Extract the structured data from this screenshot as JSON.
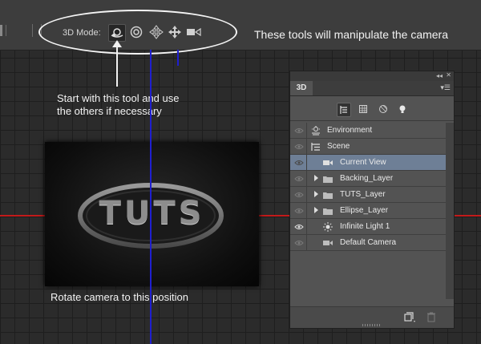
{
  "toolbar": {
    "mode_label": "3D Mode:",
    "tools": [
      {
        "name": "rotate-3d-camera-icon",
        "active": true
      },
      {
        "name": "roll-3d-camera-icon",
        "active": false
      },
      {
        "name": "drag-3d-camera-icon",
        "active": false
      },
      {
        "name": "slide-3d-camera-icon",
        "active": false
      },
      {
        "name": "zoom-3d-camera-icon",
        "active": false
      }
    ]
  },
  "annotations": {
    "tools_caption": "These tools will manipulate the camera",
    "start_line1": "Start with this tool and use",
    "start_line2": "the others if necessary",
    "rotate_caption": "Rotate camera to this position"
  },
  "canvas": {
    "logo_text": "TUTS"
  },
  "panel": {
    "tab_label": "3D",
    "filters": [
      "whole-scene-filter-icon",
      "meshes-filter-icon",
      "materials-filter-icon",
      "lights-filter-icon"
    ],
    "layers": [
      {
        "label": "Environment",
        "icon": "environment-icon",
        "indent": 0,
        "expander": false,
        "selected": false
      },
      {
        "label": "Scene",
        "icon": "scene-icon",
        "indent": 0,
        "expander": false,
        "selected": false
      },
      {
        "label": "Current View",
        "icon": "camera-icon",
        "indent": 1,
        "expander": false,
        "selected": true
      },
      {
        "label": "Backing_Layer",
        "icon": "mesh-icon",
        "indent": 1,
        "expander": true,
        "selected": false
      },
      {
        "label": "TUTS_Layer",
        "icon": "mesh-icon",
        "indent": 1,
        "expander": true,
        "selected": false
      },
      {
        "label": "Ellipse_Layer",
        "icon": "mesh-icon",
        "indent": 1,
        "expander": true,
        "selected": false
      },
      {
        "label": "Infinite Light 1",
        "icon": "light-icon",
        "indent": 1,
        "expander": false,
        "selected": false
      },
      {
        "label": "Default Camera",
        "icon": "camera-icon",
        "indent": 1,
        "expander": false,
        "selected": false
      }
    ]
  },
  "colors": {
    "x_axis": "#c21a1a",
    "y_axis": "#1f1fd0",
    "selection": "#6e7f96"
  }
}
